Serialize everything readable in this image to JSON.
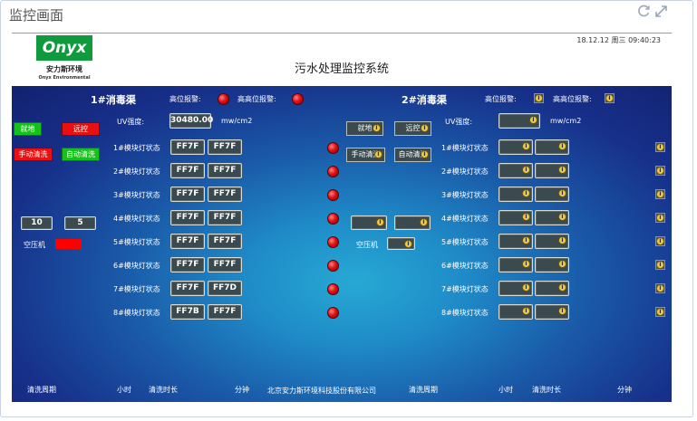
{
  "window": {
    "title": "监控画面",
    "refresh_icon": "refresh-icon",
    "expand_icon": "expand-icon"
  },
  "header": {
    "logo_text": "Onyx",
    "logo_cn": "安力斯环境",
    "logo_en": "Onyx Environmental",
    "system_title": "污水处理监控系统",
    "datetime": "18.12.12 周三 09:40:23"
  },
  "channel1": {
    "title": "1#消毒渠",
    "high_alarm_label": "高位报警:",
    "high_high_alarm_label": "高高位报警:",
    "uv_label": "UV强度:",
    "uv_value": "30480.00",
    "uv_unit": "mw/cm2",
    "buttons": {
      "local": "就地",
      "remote": "远控",
      "manual_clean": "手动清洗",
      "auto_clean": "自动清洗"
    },
    "cycle_values": [
      "10",
      "5"
    ],
    "air_compressor_label": "空压机",
    "modules": [
      {
        "label": "1#模块灯状态",
        "v1": "FF7F",
        "v2": "FF7F"
      },
      {
        "label": "2#模块灯状态",
        "v1": "FF7F",
        "v2": "FF7F"
      },
      {
        "label": "3#模块灯状态",
        "v1": "FF7F",
        "v2": "FF7F"
      },
      {
        "label": "4#模块灯状态",
        "v1": "FF7F",
        "v2": "FF7F"
      },
      {
        "label": "5#模块灯状态",
        "v1": "FF7F",
        "v2": "FF7F"
      },
      {
        "label": "6#模块灯状态",
        "v1": "FF7F",
        "v2": "FF7F"
      },
      {
        "label": "7#模块灯状态",
        "v1": "FF7F",
        "v2": "FF7D"
      },
      {
        "label": "8#模块灯状态",
        "v1": "FF7B",
        "v2": "FF7F"
      }
    ]
  },
  "channel2": {
    "title": "2#消毒渠",
    "high_alarm_label": "高位报警:",
    "high_high_alarm_label": "高高位报警:",
    "uv_label": "UV强度:",
    "uv_unit": "mw/cm2",
    "buttons": {
      "local": "就地",
      "remote": "远控",
      "manual_clean": "手动清洗",
      "auto_clean": "自动清洗"
    },
    "air_compressor_label": "空压机",
    "modules": [
      {
        "label": "1#模块灯状态"
      },
      {
        "label": "2#模块灯状态"
      },
      {
        "label": "3#模块灯状态"
      },
      {
        "label": "4#模块灯状态"
      },
      {
        "label": "5#模块灯状态"
      },
      {
        "label": "6#模块灯状态"
      },
      {
        "label": "7#模块灯状态"
      },
      {
        "label": "8#模块灯状态"
      }
    ]
  },
  "footer": {
    "clean_cycle": "清洗周期",
    "hours": "小时",
    "clean_duration": "清洗时长",
    "minutes": "分钟",
    "company": "北京安力斯环境科技股份有限公司",
    "clean_cycle_2": "清洗周期",
    "hours_2": "小时",
    "clean_duration_2": "清洗时长",
    "minutes_2": "分钟"
  },
  "colors": {
    "panel_dark": "#122170",
    "panel_light": "#27a9d4",
    "logo_green": "#0f9a3e",
    "alarm_red": "#e01010",
    "btn_green": "#15c21a"
  }
}
